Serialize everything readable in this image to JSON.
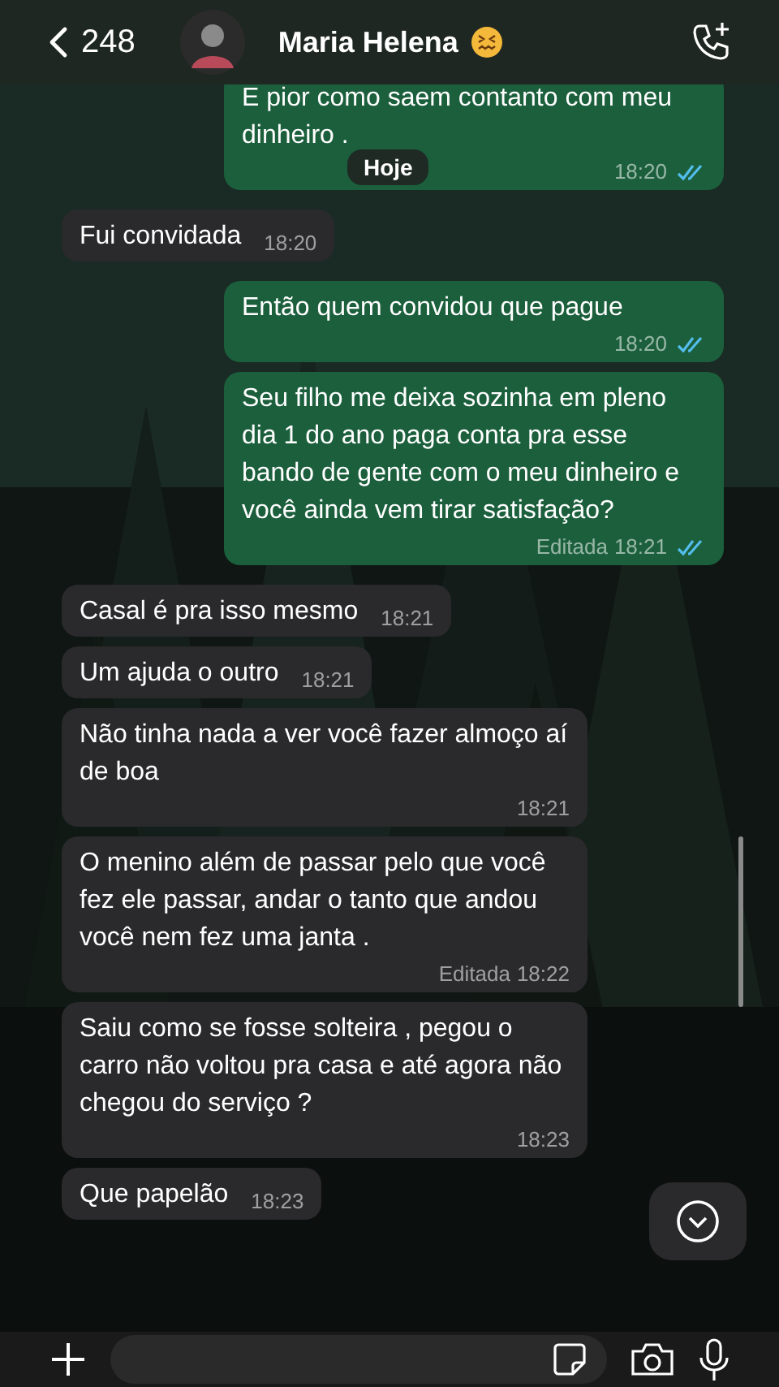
{
  "header": {
    "back_count": "248",
    "contact_name": "Maria Helena"
  },
  "date_badge": "Hoje",
  "messages": [
    {
      "kind": "sent",
      "text": "E pior como saem contanto com meu dinheiro .",
      "time": "18:20",
      "read": true
    },
    {
      "kind": "received",
      "text": "Fui convidada",
      "time": "18:20"
    },
    {
      "kind": "sent",
      "text": "Então quem convidou que pague",
      "time": "18:20",
      "read": true
    },
    {
      "kind": "sent",
      "text": "Seu filho me deixa sozinha em pleno dia 1 do ano paga conta pra esse bando de gente com o meu dinheiro e você ainda vem tirar satisfação?",
      "edited": "Editada",
      "time": "18:21",
      "read": true
    },
    {
      "kind": "received",
      "text": "Casal é pra isso mesmo",
      "time": "18:21"
    },
    {
      "kind": "received",
      "text": "Um ajuda o outro",
      "time": "18:21"
    },
    {
      "kind": "received",
      "text": "Não tinha nada a ver você fazer almoço aí de boa",
      "time": "18:21"
    },
    {
      "kind": "received",
      "text": "O menino além de passar pelo que você fez ele passar, andar o tanto que andou você nem fez uma janta .",
      "edited": "Editada",
      "time": "18:22"
    },
    {
      "kind": "received",
      "text": "Saiu como se fosse solteira , pegou o carro não voltou pra casa e até agora não chegou do serviço ?",
      "time": "18:23"
    },
    {
      "kind": "received",
      "text": "Que papelão",
      "time": "18:23"
    }
  ]
}
